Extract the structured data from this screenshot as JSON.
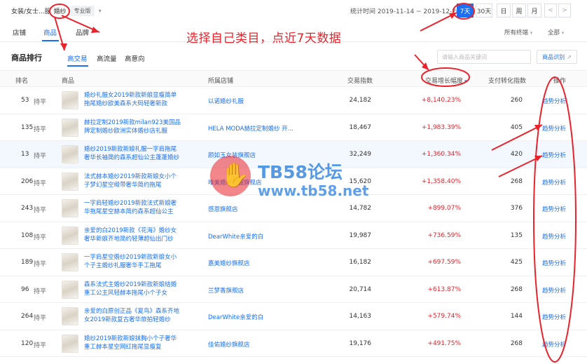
{
  "topbar": {
    "breadcrumb": "女装/女士...服",
    "category_selected": "婚纱",
    "pro_badge": "专业版",
    "stat_time": "统计时间 2019-11-14 ~ 2019-12-20",
    "ranges": [
      "7天",
      "30天",
      "日",
      "周",
      "月",
      "<",
      ">"
    ],
    "active_range": "7天"
  },
  "main_tabs": [
    "店铺",
    "商品",
    "品牌"
  ],
  "active_main_tab": "商品",
  "annotation_text": "选择自己类目，点近7天数据",
  "filters": {
    "terminal": "所有终端",
    "scope": "全部"
  },
  "section": {
    "title": "商品排行",
    "tabs": [
      "高交易",
      "高流量",
      "高意向"
    ],
    "active_tab": "高交易",
    "search_placeholder": "请输入商品关键词",
    "search_button": "商品识别"
  },
  "table": {
    "headers": [
      "排名",
      "商品",
      "所属店铺",
      "交易指数",
      "交易增长幅度",
      "支付转化指数",
      "操作"
    ],
    "rows": [
      {
        "rank": "53",
        "trend": "持平",
        "name": "婚纱礼服女2019新款新娘显瘦简单拖尾婚纱欧美森系大码轻奢新款",
        "shop": "以诺婚纱礼服",
        "trade": "24,182",
        "growth": "+8,140.23%",
        "conversion": "260",
        "action": "趋势分析"
      },
      {
        "rank": "135",
        "trend": "持平",
        "name": "赫拉定制2019新款milan923美国品牌定制婚纱欧洲实体婚纱店礼服",
        "shop": "HELA MODA赫拉定制婚纱 开...",
        "trade": "18,467",
        "growth": "+1,983.39%",
        "conversion": "405",
        "action": "趋势分析"
      },
      {
        "rank": "13",
        "trend": "持平",
        "name": "婚纱2019新款新娘礼服一字肩拖尾奢华长袖简约森系超仙公主蓬蓬婚纱",
        "shop": "颜如玉女装旗舰店",
        "trade": "32,249",
        "growth": "+1,360.34%",
        "conversion": "420",
        "action": "趋势分析"
      },
      {
        "rank": "206",
        "trend": "持平",
        "name": "法式赫本婚纱2019新款新娘女小个子梦幻星空缎带奢华简约拖尾",
        "shop": "唯美婚纱礼服旗舰店",
        "trade": "15,620",
        "growth": "+1,358.40%",
        "conversion": "268",
        "action": "趋势分析"
      },
      {
        "rank": "243",
        "trend": "持平",
        "name": "一字肩轻婚纱2019新款法式新娘奢华拖尾星空赫本简约森系超仙公主",
        "shop": "感恩旗舰店",
        "trade": "14,782",
        "growth": "+899.07%",
        "conversion": "376",
        "action": "趋势分析"
      },
      {
        "rank": "108",
        "trend": "持平",
        "name": "亲爱的白2019新款《花海》婚纱女奢华新娘齐地简约轻薄超仙出门纱",
        "shop": "DearWhite亲爱的白",
        "trade": "19,987",
        "growth": "+736.59%",
        "conversion": "135",
        "action": "趋势分析"
      },
      {
        "rank": "189",
        "trend": "持平",
        "name": "一字肩星空婚纱2019新款新娘女小个子主婚纱礼服奢华手工拖尾",
        "shop": "嘉美婚纱旗舰店",
        "trade": "16,182",
        "growth": "+697.59%",
        "conversion": "425",
        "action": "趋势分析"
      },
      {
        "rank": "96",
        "trend": "持平",
        "name": "森系法式主婚纱2019新款新娘结婚重工公主风轻赫本拖尾小个子女",
        "shop": "兰梦香旗舰店",
        "trade": "20,714",
        "growth": "+613.87%",
        "conversion": "268",
        "action": "趋势分析"
      },
      {
        "rank": "264",
        "trend": "持平",
        "name": "亲爱的白原创正品《夏鸟》森系齐地女2019新款复古奢华旅拍轻婚纱",
        "shop": "DearWhite亲爱的白",
        "trade": "14,163",
        "growth": "+579.74%",
        "conversion": "144",
        "action": "趋势分析"
      },
      {
        "rank": "120",
        "trend": "持平",
        "name": "婚纱2019新款新娘抹胸小个子奢华重工赫本星空网红拖尾显瘦复",
        "shop": "佳佑婚纱旗舰店",
        "trade": "19,176",
        "growth": "+491.75%",
        "conversion": "268",
        "action": "趋势分析"
      }
    ]
  },
  "watermark": {
    "title": "TB58论坛",
    "url": "www.tb58.net"
  },
  "colors": {
    "accent": "#1c6ff2",
    "growth": "#e8232c",
    "annotation": "#e8232c"
  }
}
